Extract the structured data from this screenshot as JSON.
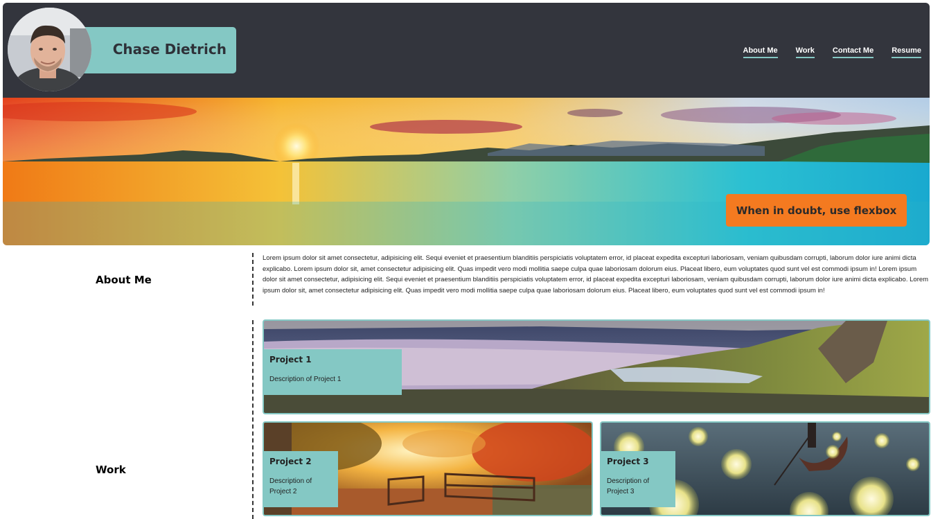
{
  "header": {
    "name": "Chase Dietrich",
    "nav": [
      "About Me",
      "Work",
      "Contact Me",
      "Resume"
    ]
  },
  "hero": {
    "cta_label": "When in doubt, use flexbox"
  },
  "sections": {
    "about_label": "About Me",
    "work_label": "Work",
    "about_text": "Lorem ipsum dolor sit amet consectetur, adipisicing elit. Sequi eveniet et praesentium blanditiis perspiciatis voluptatem error, id placeat expedita excepturi laboriosam, veniam quibusdam corrupti, laborum dolor iure animi dicta explicabo. Lorem ipsum dolor sit, amet consectetur adipisicing elit. Quas impedit vero modi mollitia saepe culpa quae laboriosam dolorum eius. Placeat libero, eum voluptates quod sunt vel est commodi ipsum in! Lorem ipsum dolor sit amet consectetur, adipisicing elit. Sequi eveniet et praesentium blanditiis perspiciatis voluptatem error, id placeat expedita excepturi laboriosam, veniam quibusdam corrupti, laborum dolor iure animi dicta explicabo. Lorem ipsum dolor sit, amet consectetur adipisicing elit. Quas impedit vero modi mollitia saepe culpa quae laboriosam dolorum eius. Placeat libero, eum voluptates quod sunt vel est commodi ipsum in!"
  },
  "projects": [
    {
      "title": "Project 1",
      "description": "Description of Project 1"
    },
    {
      "title": "Project 2",
      "description": "Description of Project 2"
    },
    {
      "title": "Project 3",
      "description": "Description of Project 3"
    }
  ],
  "colors": {
    "header_bg": "#33353d",
    "accent": "#84c8c4",
    "cta": "#f47a20"
  }
}
